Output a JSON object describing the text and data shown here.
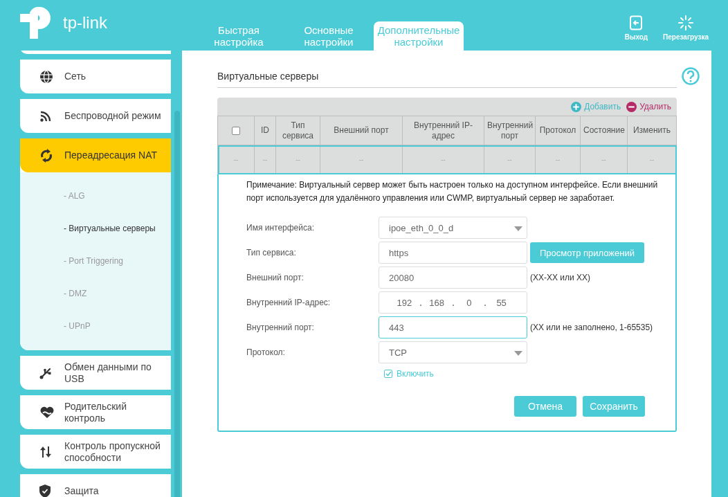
{
  "header": {
    "logo": "tp-link",
    "tabs": [
      {
        "label": "Быстрая настройка",
        "selected": false
      },
      {
        "label": "Основные настройки",
        "selected": false
      },
      {
        "label": "Дополнительные настройки",
        "selected": true
      }
    ],
    "actions": [
      {
        "kind": "logout",
        "label": "Выход"
      },
      {
        "kind": "reboot",
        "label": "Перезагрузка"
      }
    ]
  },
  "sidebar": {
    "items": [
      {
        "label": "Сеть",
        "selected": false
      },
      {
        "label": "Беспроводной режим",
        "selected": false
      },
      {
        "label": "Переадресация NAT",
        "selected": true,
        "children": [
          {
            "label": "- ALG",
            "selected": false
          },
          {
            "label": "- Виртуальные серверы",
            "selected": true
          },
          {
            "label": "- Port Triggering",
            "selected": false
          },
          {
            "label": "- DMZ",
            "selected": false
          },
          {
            "label": "- UPnP",
            "selected": false
          }
        ]
      },
      {
        "label": "Обмен данными по USB",
        "selected": false
      },
      {
        "label": "Родительский контроль",
        "selected": false
      },
      {
        "label": "Контроль пропускной способности",
        "selected": false
      },
      {
        "label": "Защита",
        "selected": false
      }
    ]
  },
  "main": {
    "title": "Виртуальные серверы",
    "table": {
      "actions": [
        {
          "kind": "add",
          "label": "Добавить"
        },
        {
          "kind": "delete",
          "label": "Удалить"
        }
      ],
      "columns": [
        {
          "kind": "checkbox",
          "checked": false
        },
        {
          "kind": "text",
          "label": "ID"
        },
        {
          "kind": "text",
          "label": "Тип сервиса"
        },
        {
          "kind": "text",
          "label": "Внешний порт"
        },
        {
          "kind": "text",
          "label": "Внутренний IP-адрес"
        },
        {
          "kind": "text",
          "label": "Внутренний порт"
        },
        {
          "kind": "text",
          "label": "Протокол"
        },
        {
          "kind": "text",
          "label": "Состояние"
        },
        {
          "kind": "text",
          "label": "Изменить"
        }
      ],
      "rows": [
        [
          "--",
          "--",
          "--",
          "--",
          "--",
          "--",
          "--",
          "--",
          "--"
        ]
      ]
    },
    "form": {
      "note": "Примечание: Виртуальный сервер может быть настроен только на доступном интерфейсе. Если внешний порт используется для удалённого управления или CWMP, виртуальный сервер не заработает.",
      "fields": [
        {
          "kind": "select",
          "label": "Имя интерфейса:",
          "value": "ipoe_eth_0_0_d",
          "focused": false
        },
        {
          "kind": "text",
          "label": "Тип сервиса:",
          "value": "https",
          "button": "Просмотр приложений",
          "focused": false
        },
        {
          "kind": "text",
          "label": "Внешний порт:",
          "value": "20080",
          "hint": "(XX-XX или XX)",
          "focused": false
        },
        {
          "kind": "ip",
          "label": "Внутренний IP-адрес:",
          "octets": [
            "192",
            "168",
            "0",
            "55"
          ],
          "focused": false
        },
        {
          "kind": "text",
          "label": "Внутренний порт:",
          "value": "443",
          "hint": "(XX или не заполнено, 1-65535)",
          "focused": true
        },
        {
          "kind": "select",
          "label": "Протокол:",
          "value": "TCP",
          "focused": false
        }
      ],
      "enable": {
        "label": "Включить",
        "checked": true
      },
      "buttons": [
        "Отмена",
        "Сохранить"
      ]
    }
  }
}
